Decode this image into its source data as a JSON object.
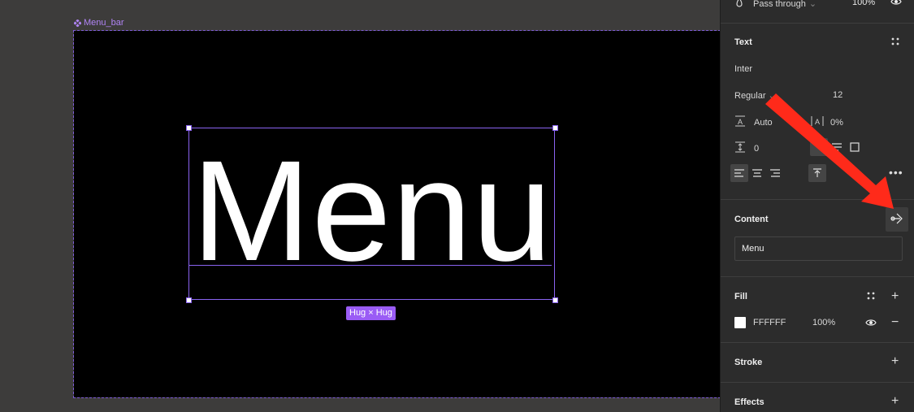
{
  "canvas": {
    "frame_label": "Menu_bar",
    "text_content": "Menu",
    "size_badge": "Hug × Hug"
  },
  "panel": {
    "layer": {
      "blend_mode": "Pass through",
      "opacity": "100%"
    },
    "text": {
      "title": "Text",
      "font_family": "Inter",
      "font_weight": "Regular",
      "font_size": "12",
      "line_height": "Auto",
      "letter_spacing": "0%",
      "paragraph_spacing": "0"
    },
    "content": {
      "title": "Content",
      "value": "Menu"
    },
    "fill": {
      "title": "Fill",
      "hex": "FFFFFF",
      "opacity": "100%",
      "swatch_color": "#FFFFFF"
    },
    "stroke": {
      "title": "Stroke"
    },
    "effects": {
      "title": "Effects"
    }
  },
  "colors": {
    "selection": "#8a63f0",
    "annotation_arrow": "#ff2a1a"
  }
}
